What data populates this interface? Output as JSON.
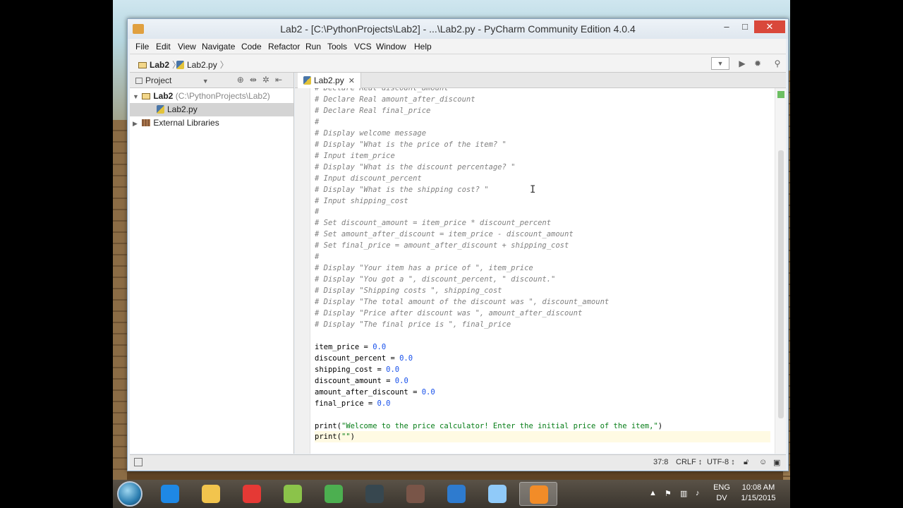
{
  "window": {
    "title": "Lab2 - [C:\\PythonProjects\\Lab2] - ...\\Lab2.py - PyCharm Community Edition 4.0.4",
    "min_glyph": "–",
    "max_glyph": "□",
    "close_glyph": "✕"
  },
  "menu": [
    "File",
    "Edit",
    "View",
    "Navigate",
    "Code",
    "Refactor",
    "Run",
    "Tools",
    "VCS",
    "Window",
    "Help"
  ],
  "breadcrumb": {
    "project": "Lab2",
    "file": "Lab2.py"
  },
  "project_panel": {
    "title": "Project",
    "root": "Lab2",
    "root_path": "(C:\\PythonProjects\\Lab2)",
    "file": "Lab2.py",
    "libraries": "External Libraries"
  },
  "editor": {
    "tab": "Lab2.py",
    "lines": [
      {
        "text": "# Declare Real discount_amount",
        "kind": "comment"
      },
      {
        "text": "# Declare Real amount_after_discount",
        "kind": "comment"
      },
      {
        "text": "# Declare Real final_price",
        "kind": "comment"
      },
      {
        "text": "#",
        "kind": "comment"
      },
      {
        "text": "# Display welcome message",
        "kind": "comment"
      },
      {
        "text": "# Display \"What is the price of the item? \"",
        "kind": "comment"
      },
      {
        "text": "# Input item_price",
        "kind": "comment"
      },
      {
        "text": "# Display \"What is the discount percentage? \"",
        "kind": "comment"
      },
      {
        "text": "# Input discount_percent",
        "kind": "comment"
      },
      {
        "text": "# Display \"What is the shipping cost? \"",
        "kind": "comment"
      },
      {
        "text": "# Input shipping_cost",
        "kind": "comment"
      },
      {
        "text": "#",
        "kind": "comment"
      },
      {
        "text": "# Set discount_amount = item_price * discount_percent",
        "kind": "comment"
      },
      {
        "text": "# Set amount_after_discount = item_price - discount_amount",
        "kind": "comment"
      },
      {
        "text": "# Set final_price = amount_after_discount + shipping_cost",
        "kind": "comment"
      },
      {
        "text": "#",
        "kind": "comment"
      },
      {
        "text": "# Display \"Your item has a price of \", item_price",
        "kind": "comment"
      },
      {
        "text": "# Display \"You got a \", discount_percent, \" discount.\"",
        "kind": "comment"
      },
      {
        "text": "# Display \"Shipping costs \", shipping_cost",
        "kind": "comment"
      },
      {
        "text": "# Display \"The total amount of the discount was \", discount_amount",
        "kind": "comment"
      },
      {
        "text": "# Display \"Price after discount was \", amount_after_discount",
        "kind": "comment"
      },
      {
        "text": "# Display \"The final price is \", final_price",
        "kind": "comment"
      },
      {
        "text": "",
        "kind": "blank"
      },
      {
        "text": "item_price = ",
        "value": "0.0",
        "kind": "assign"
      },
      {
        "text": "discount_percent = ",
        "value": "0.0",
        "kind": "assign"
      },
      {
        "text": "shipping_cost = ",
        "value": "0.0",
        "kind": "assign"
      },
      {
        "text": "discount_amount = ",
        "value": "0.0",
        "kind": "assign"
      },
      {
        "text": "amount_after_discount = ",
        "value": "0.0",
        "kind": "assign"
      },
      {
        "text": "final_price = ",
        "value": "0.0",
        "kind": "assign"
      },
      {
        "text": "",
        "kind": "blank"
      },
      {
        "text": "print(",
        "value": "\"Welcome to the price calculator! Enter the initial price of the item,\"",
        "tail": ")",
        "kind": "print"
      },
      {
        "text": "print(",
        "value": "\"\"",
        "tail": ")",
        "kind": "print",
        "current": true
      }
    ]
  },
  "status": {
    "position": "37:8",
    "line_sep": "CRLF ↕",
    "encoding": "UTF-8 ↕"
  },
  "taskbar": {
    "lang": "ENG",
    "lang_sub": "DV",
    "time": "10:08 AM",
    "date": "1/15/2015"
  },
  "colors": {
    "taskbar_icons": [
      "#1e88e5",
      "#f2c44d",
      "#e53935",
      "#8bc34a",
      "#4caf50",
      "#37474f",
      "#795548",
      "#2e7bcf",
      "#90caf9",
      "#f28c28"
    ]
  }
}
